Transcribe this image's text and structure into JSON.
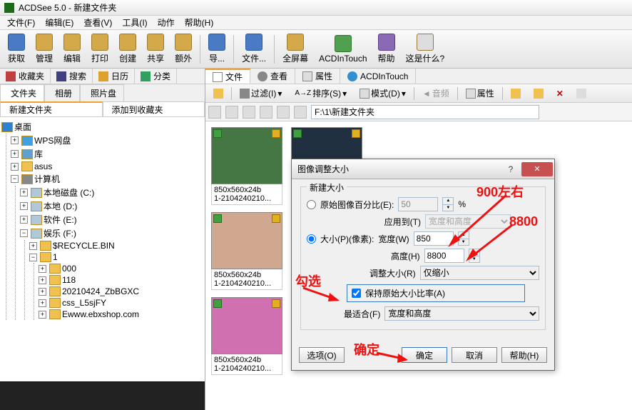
{
  "app": {
    "title": "ACDSee 5.0 - 新建文件夹"
  },
  "menu": {
    "file": "文件(F)",
    "edit": "编辑(E)",
    "view": "查看(V)",
    "tools": "工具(I)",
    "actions": "动作",
    "help": "帮助(H)"
  },
  "tb": {
    "acquire": "获取",
    "manage": "管理",
    "edit": "编辑",
    "print": "打印",
    "create": "创建",
    "share": "共享",
    "extra": "额外",
    "nav": "导...",
    "file": "文件...",
    "fullscreen": "全屏幕",
    "acdintouch": "ACDInTouch",
    "help": "帮助",
    "whatsthis": "这是什么?"
  },
  "ltabs": {
    "fav": "收藏夹",
    "search": "搜索",
    "calendar": "日历",
    "category": "分类"
  },
  "ltabs2": {
    "folders": "文件夹",
    "albums": "相册",
    "photodisc": "照片盘"
  },
  "subtabs": {
    "newfolder": "新建文件夹",
    "addfav": "添加到收藏夹"
  },
  "tree": {
    "desktop": "桌面",
    "wps": "WPS网盘",
    "lib": "库",
    "asus": "asus",
    "computer": "计算机",
    "cdrive": "本地磁盘 (C:)",
    "ddrive": "本地 (D:)",
    "edrive": "软件 (E:)",
    "fdrive": "娱乐 (F:)",
    "recycle": "$RECYCLE.BIN",
    "folder1": "1",
    "f000": "000",
    "f118": "118",
    "fdate": "20210424_ZbBGXC",
    "fcss": "css_L5sjFY",
    "fewww": "Ewww.ebxshop.com"
  },
  "rtabs": {
    "file": "文件",
    "view": "查看",
    "props": "属性",
    "acdin": "ACDInTouch"
  },
  "rtoolbar": {
    "filter": "过滤(I)",
    "sort": "排序(S)",
    "mode": "模式(D)",
    "audio": "音频",
    "props": "属性"
  },
  "path": "F:\\1\\新建文件夹",
  "thumb": {
    "dims": "850x560x24b",
    "name": "1-2104240210..."
  },
  "dialog": {
    "title": "图像调整大小",
    "newsize": "新建大小",
    "origpercent": "原始图像百分比(E):",
    "percent_val": "50",
    "percent_sym": "%",
    "applyto": "应用到(T)",
    "wh": "宽度和高度",
    "sizepx": "大小(P)(像素):",
    "width": "宽度(W)",
    "width_val": "850",
    "height": "高度(H)",
    "height_val": "8800",
    "resize": "调整大小(R)",
    "shrinkonly": "仅缩小",
    "keepratio": "保持原始大小比率(A)",
    "bestfit": "最适合(F)",
    "options": "选项(O)",
    "ok": "确定",
    "cancel": "取消",
    "help": "帮助(H)"
  },
  "annot": {
    "a1": "900左右",
    "a2": "8800",
    "a3": "勾选",
    "a4": "确定"
  }
}
